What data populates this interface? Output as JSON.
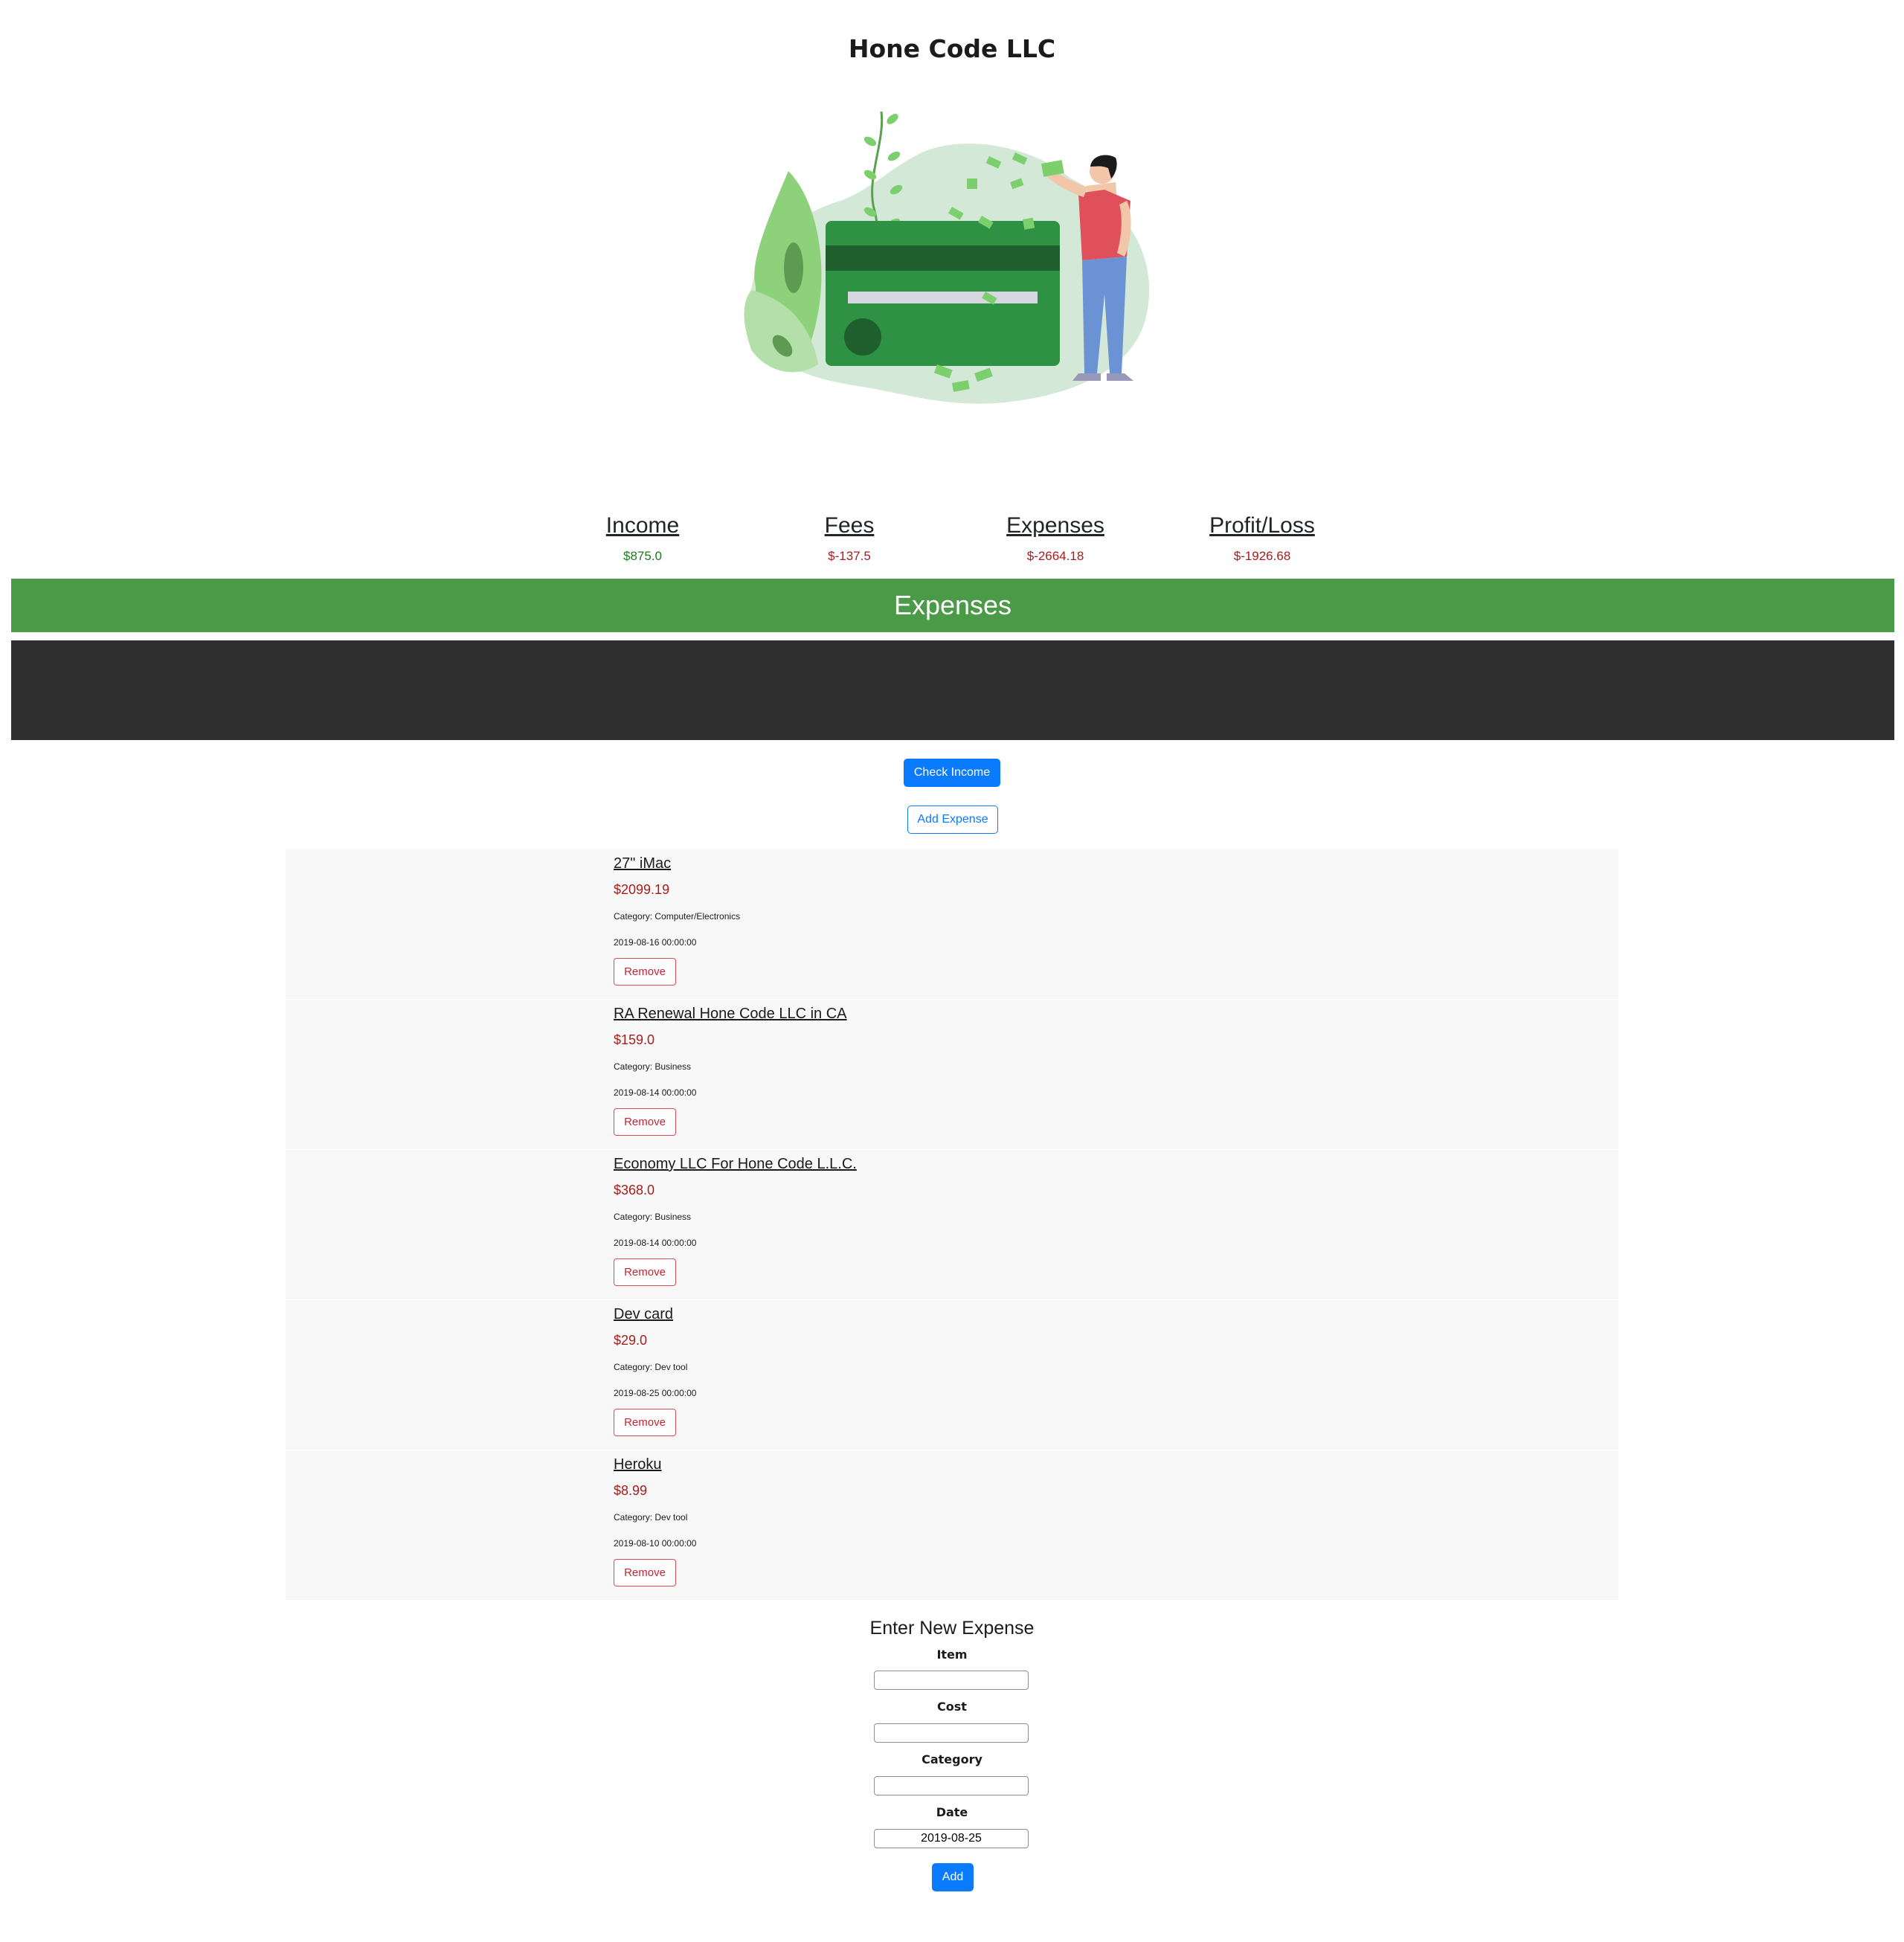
{
  "header": {
    "title": "Hone Code LLC"
  },
  "summary": [
    {
      "label": "Income",
      "value": "$875.0"
    },
    {
      "label": "Fees",
      "value": "$-137.5"
    },
    {
      "label": "Expenses",
      "value": "$-2664.18"
    },
    {
      "label": "Profit/Loss",
      "value": "$-1926.68"
    }
  ],
  "section": {
    "title": "Expenses"
  },
  "actions": {
    "check_income": "Check Income",
    "add_expense": "Add Expense"
  },
  "expenses": [
    {
      "name": "27\" iMac",
      "cost": "$2099.19",
      "category": "Category: Computer/Electronics",
      "date": "2019-08-16 00:00:00",
      "remove": "Remove"
    },
    {
      "name": "RA Renewal Hone Code LLC in CA",
      "cost": "$159.0",
      "category": "Category: Business",
      "date": "2019-08-14 00:00:00",
      "remove": "Remove"
    },
    {
      "name": "Economy LLC For Hone Code L.L.C.",
      "cost": "$368.0",
      "category": "Category: Business",
      "date": "2019-08-14 00:00:00",
      "remove": "Remove"
    },
    {
      "name": "Dev card",
      "cost": "$29.0",
      "category": "Category: Dev tool",
      "date": "2019-08-25 00:00:00",
      "remove": "Remove"
    },
    {
      "name": "Heroku",
      "cost": "$8.99",
      "category": "Category: Dev tool",
      "date": "2019-08-10 00:00:00",
      "remove": "Remove"
    }
  ],
  "form": {
    "title": "Enter New Expense",
    "item_label": "Item",
    "item_value": "",
    "cost_label": "Cost",
    "cost_value": "",
    "category_label": "Category",
    "category_value": "",
    "date_label": "Date",
    "date_value": "2019-08-25",
    "submit": "Add"
  },
  "colors": {
    "section_green": "#4a9a48",
    "dark_bar": "#2f2f2f",
    "primary_blue": "#0a7bff",
    "income_green": "#1f7a1f",
    "negative_red": "#a71d1d",
    "remove_red": "#c8232f"
  }
}
